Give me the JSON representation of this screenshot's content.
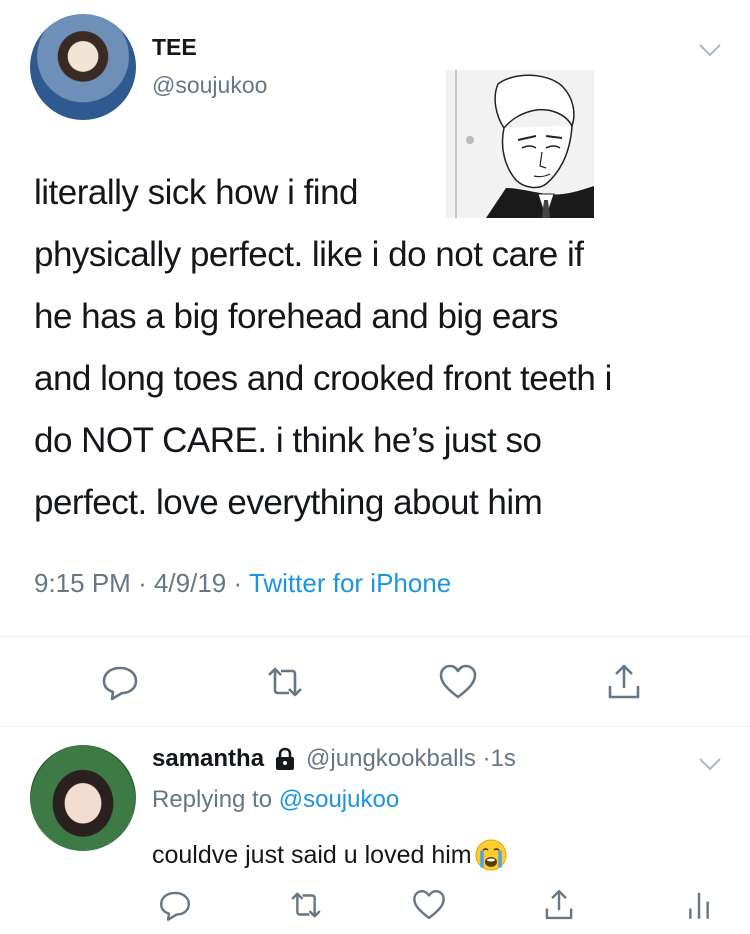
{
  "tweet": {
    "display_name": "TEE",
    "handle": "@soujukoo",
    "text_lines": [
      "literally sick how i find",
      "physically perfect. like i do not care if",
      "he has a big forehead and big ears",
      "and long toes and crooked front teeth i",
      "do NOT CARE. i think he’s just so",
      "perfect. love everything about him"
    ],
    "time": "9:15 PM",
    "date": "4/9/19",
    "separator": "·",
    "source": "Twitter for iPhone",
    "actions": [
      "reply-icon",
      "retweet-icon",
      "like-icon",
      "share-icon"
    ]
  },
  "reply": {
    "display_name": "samantha",
    "handle": "@jungkookballs",
    "time": "1s",
    "separator": "·",
    "replying_prefix": "Replying to",
    "replying_to": "@soujukoo",
    "text": "couldve just said u loved him",
    "emoji": "crying-face-emoji",
    "actions": [
      "reply-icon",
      "retweet-icon",
      "like-icon",
      "share-icon",
      "analytics-icon"
    ]
  },
  "colors": {
    "text": "#14171a",
    "secondary": "#657786",
    "link": "#1b95e0",
    "divider": "#e6ecf0"
  }
}
